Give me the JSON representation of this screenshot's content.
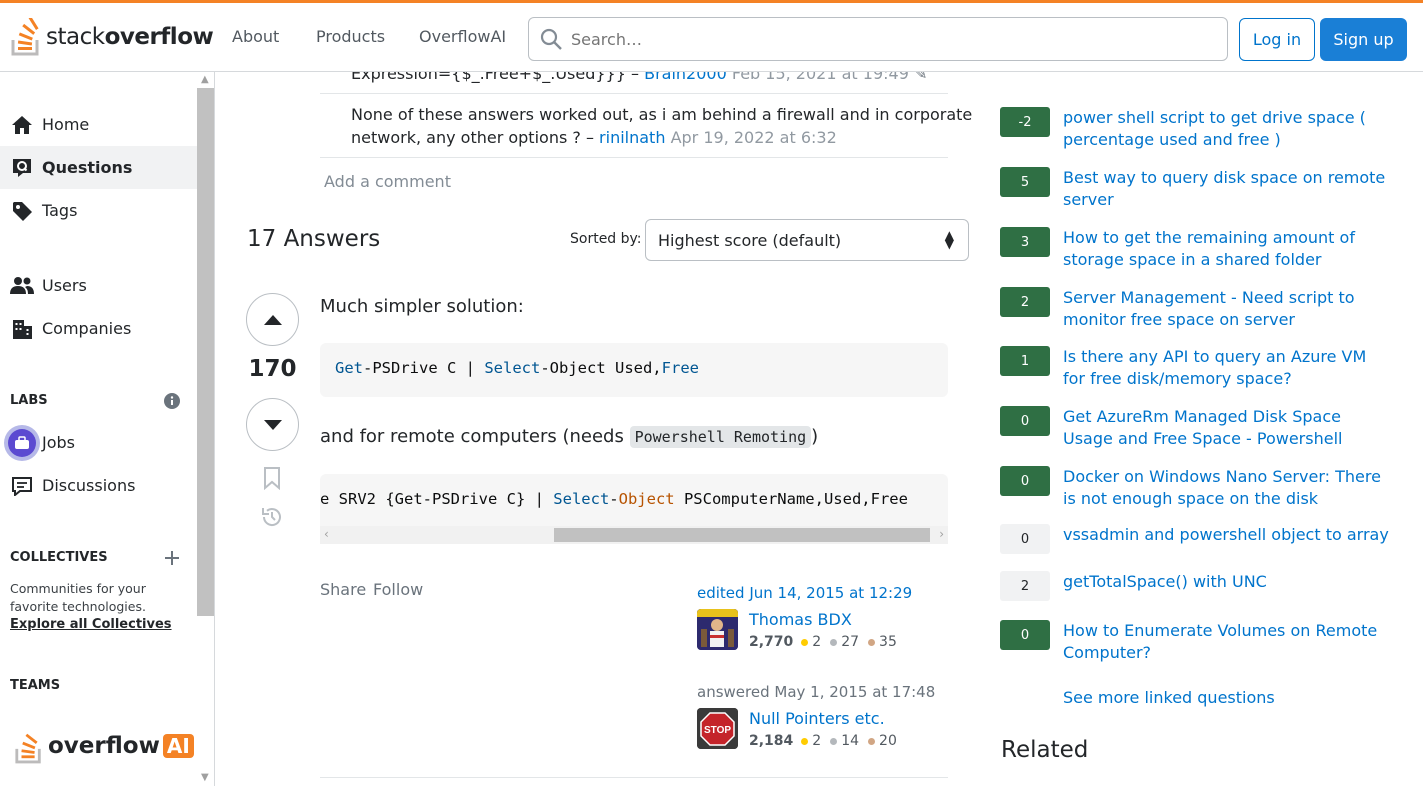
{
  "header": {
    "logo_light": "stack",
    "logo_bold": "overflow",
    "nav": [
      "About",
      "Products",
      "OverflowAI"
    ],
    "search_placeholder": "Search…",
    "login": "Log in",
    "signup": "Sign up",
    "accent_color": "#f48225"
  },
  "sidebar": {
    "items": [
      {
        "label": "Home",
        "icon": "home-icon"
      },
      {
        "label": "Questions",
        "icon": "questions-icon",
        "active": true
      },
      {
        "label": "Tags",
        "icon": "tag-icon"
      },
      {
        "label": "Users",
        "icon": "users-icon"
      },
      {
        "label": "Companies",
        "icon": "companies-icon"
      }
    ],
    "labs_title": "LABS",
    "labs_items": [
      {
        "label": "Jobs",
        "icon": "jobs-icon"
      },
      {
        "label": "Discussions",
        "icon": "discussions-icon"
      }
    ],
    "collectives_title": "COLLECTIVES",
    "collectives_text": "Communities for your favorite technologies.",
    "collectives_link": "Explore all Collectives",
    "teams_title": "TEAMS",
    "teams_logo_text": "overflow",
    "teams_logo_badge": "AI"
  },
  "comments": [
    {
      "text": "Expression={$_.Free+$_.Used}}} –",
      "user": "Brain2000",
      "time": "Feb 15, 2021 at 19:49"
    },
    {
      "text_line1": "None of these answers worked out, as i am behind a firewall and in corporate",
      "text_line2": "network, any other options ? –",
      "user": "rinilnath",
      "time": "Apr 19, 2022 at 6:32"
    }
  ],
  "add_comment": "Add a comment",
  "answers": {
    "count_label": "17 Answers",
    "sorted_label": "Sorted by:",
    "sort_value": "Highest score (default)"
  },
  "answer": {
    "score": "170",
    "p1": "Much simpler solution:",
    "code1": {
      "t1": "Get",
      "t2": "-PSDrive C | ",
      "t3": "Select",
      "t4": "-Object Used,",
      "t5": "Free"
    },
    "p2_pre": "and for remote computers (needs ",
    "p2_code": "Powershell Remoting",
    "p2_post": ")",
    "code2": {
      "t1": "e SRV2 {Get-PSDrive C} | ",
      "t2": "Select",
      "t3": "-",
      "t4": "Object",
      "t5": " PSComputerName,Used,Free"
    },
    "share": "Share",
    "follow": "Follow",
    "edited_prefix": "edited",
    "edited_time": "Jun 14, 2015 at 12:29",
    "editor": {
      "name": "Thomas BDX",
      "rep": "2,770",
      "gold": "2",
      "silver": "27",
      "bronze": "35"
    },
    "answered_prefix": "answered",
    "answered_time": "May 1, 2015 at 17:48",
    "author": {
      "name": "Null Pointers etc.",
      "rep": "2,184",
      "gold": "2",
      "silver": "14",
      "bronze": "20"
    }
  },
  "linked": [
    {
      "score": "-2",
      "accepted": true,
      "title": "power shell script to get drive space ( percentage used and free )"
    },
    {
      "score": "5",
      "accepted": true,
      "title": "Best way to query disk space on remote server"
    },
    {
      "score": "3",
      "accepted": true,
      "title": "How to get the remaining amount of storage space in a shared folder"
    },
    {
      "score": "2",
      "accepted": true,
      "title": "Server Management - Need script to monitor free space on server"
    },
    {
      "score": "1",
      "accepted": true,
      "title": "Is there any API to query an Azure VM for free disk/memory space?"
    },
    {
      "score": "0",
      "accepted": true,
      "title": "Get AzureRm Managed Disk Space Usage and Free Space - Powershell"
    },
    {
      "score": "0",
      "accepted": true,
      "title": "Docker on Windows Nano Server: There is not enough space on the disk"
    },
    {
      "score": "0",
      "accepted": false,
      "title": "vssadmin and powershell object to array"
    },
    {
      "score": "2",
      "accepted": false,
      "title": "getTotalSpace() with UNC"
    },
    {
      "score": "0",
      "accepted": true,
      "title": "How to Enumerate Volumes on Remote Computer?"
    }
  ],
  "see_more": "See more linked questions",
  "related_title": "Related"
}
